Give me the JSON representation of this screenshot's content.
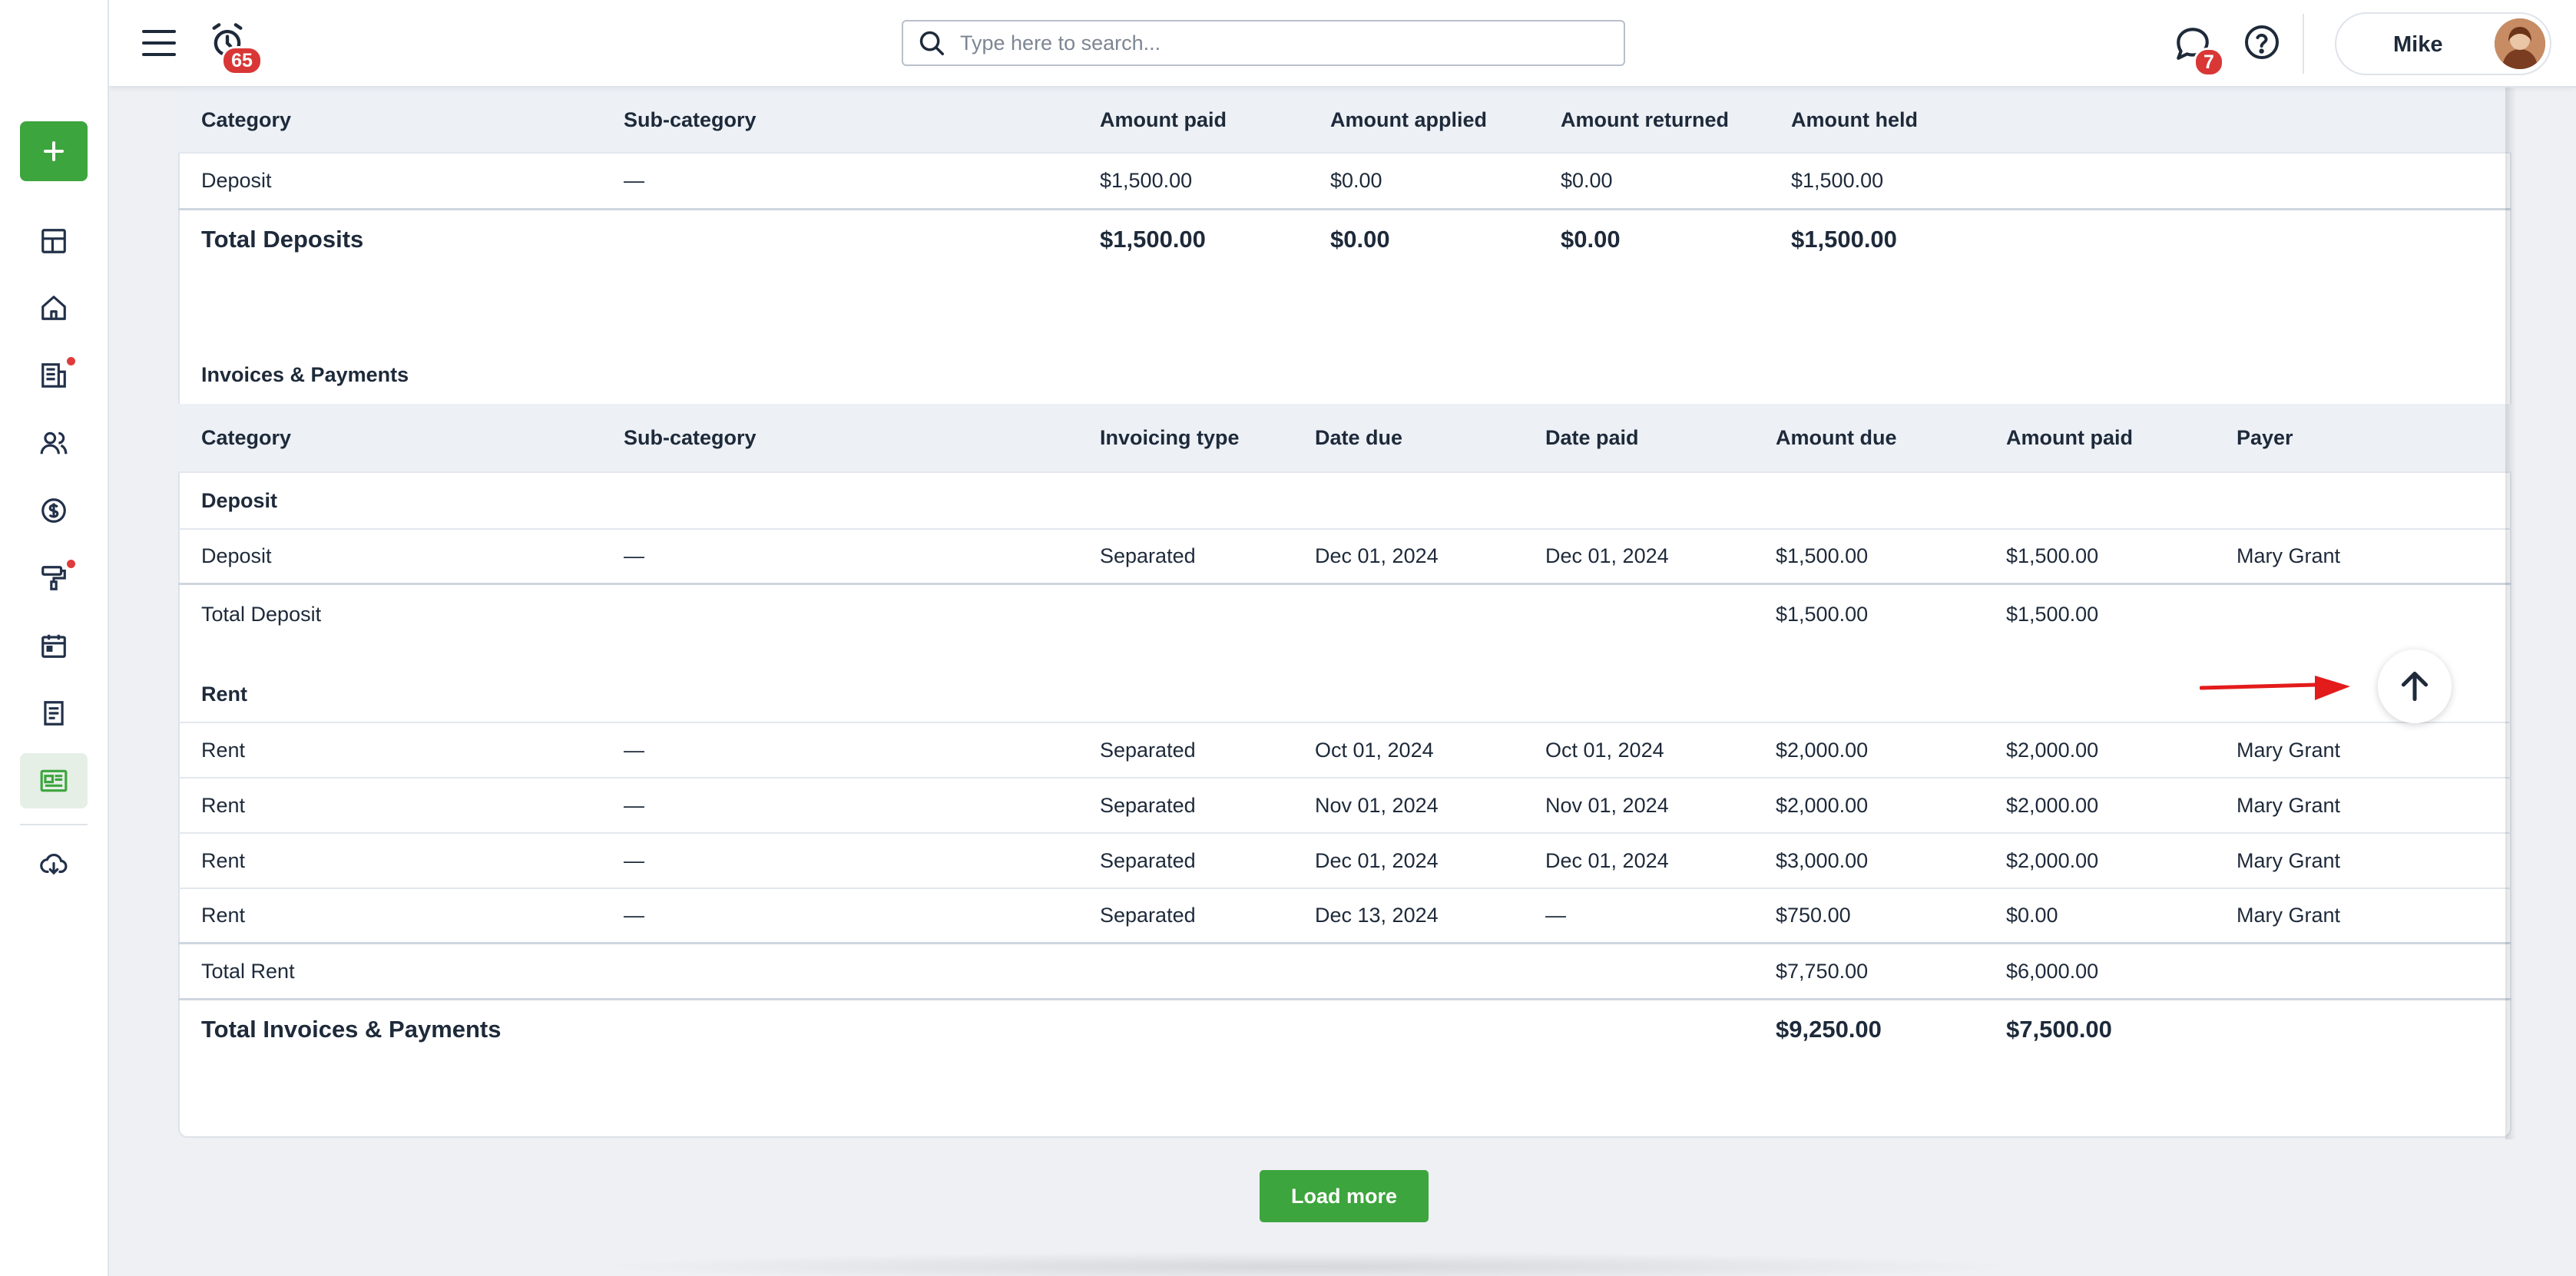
{
  "topbar": {
    "alarm_count": "65",
    "search_placeholder": "Type here to search...",
    "chat_count": "7",
    "user_name": "Mike"
  },
  "deposits_table": {
    "headers": [
      "Category",
      "Sub-category",
      "Amount paid",
      "Amount applied",
      "Amount returned",
      "Amount held"
    ],
    "rows": [
      [
        "Deposit",
        "—",
        "$1,500.00",
        "$0.00",
        "$0.00",
        "$1,500.00"
      ]
    ],
    "total": [
      "Total Deposits",
      "$1,500.00",
      "$0.00",
      "$0.00",
      "$1,500.00"
    ]
  },
  "invoices": {
    "title": "Invoices & Payments",
    "headers": [
      "Category",
      "Sub-category",
      "Invoicing type",
      "Date due",
      "Date paid",
      "Amount due",
      "Amount paid",
      "Payer"
    ],
    "groups": [
      {
        "name": "Deposit",
        "rows": [
          [
            "Deposit",
            "—",
            "Separated",
            "Dec 01, 2024",
            "Dec 01, 2024",
            "$1,500.00",
            "$1,500.00",
            "Mary Grant"
          ]
        ],
        "total": [
          "Total Deposit",
          "$1,500.00",
          "$1,500.00"
        ]
      },
      {
        "name": "Rent",
        "rows": [
          [
            "Rent",
            "—",
            "Separated",
            "Oct 01, 2024",
            "Oct 01, 2024",
            "$2,000.00",
            "$2,000.00",
            "Mary Grant"
          ],
          [
            "Rent",
            "—",
            "Separated",
            "Nov 01, 2024",
            "Nov 01, 2024",
            "$2,000.00",
            "$2,000.00",
            "Mary Grant"
          ],
          [
            "Rent",
            "—",
            "Separated",
            "Dec 01, 2024",
            "Dec 01, 2024",
            "$3,000.00",
            "$2,000.00",
            "Mary Grant"
          ],
          [
            "Rent",
            "—",
            "Separated",
            "Dec 13, 2024",
            "—",
            "$750.00",
            "$0.00",
            "Mary Grant"
          ]
        ],
        "total": [
          "Total Rent",
          "$7,750.00",
          "$6,000.00"
        ]
      }
    ],
    "grand_total": [
      "Total Invoices & Payments",
      "$9,250.00",
      "$7,500.00"
    ]
  },
  "load_more_label": "Load more",
  "colors": {
    "accent_green": "#3da53d",
    "badge_red": "#d93636",
    "annotation_arrow": "#e31b1b"
  }
}
